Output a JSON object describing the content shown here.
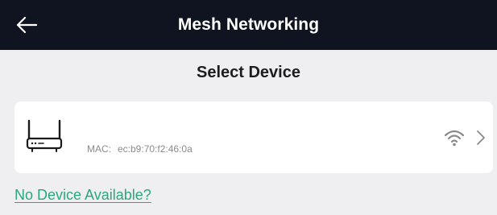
{
  "header": {
    "title": "Mesh Networking",
    "back_icon": "arrow-left-icon",
    "background": "#0f1420"
  },
  "section": {
    "title": "Select Device"
  },
  "device": {
    "icon": "router-icon",
    "mac_label": "MAC:",
    "mac_value": "ec:b9:70:f2:46:0a",
    "signal_icon": "wifi-signal-icon",
    "chevron_icon": "chevron-right-icon"
  },
  "help": {
    "link_text": "No Device Available?"
  },
  "colors": {
    "accent": "#2aa77d",
    "page_background": "#efeff2",
    "card_background": "#ffffff"
  }
}
